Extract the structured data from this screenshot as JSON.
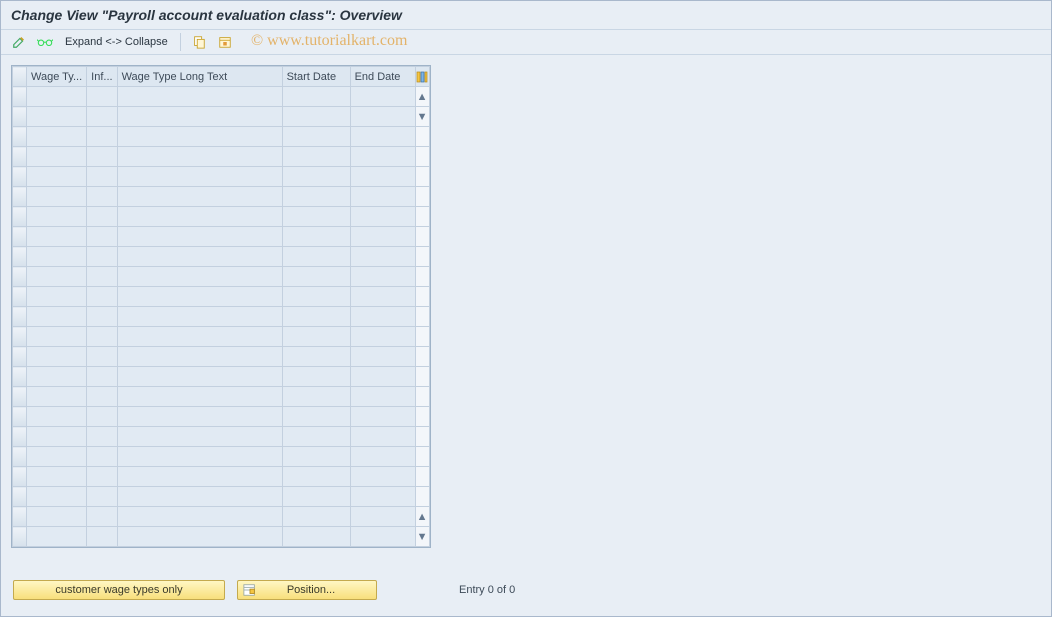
{
  "title": "Change View \"Payroll account evaluation class\": Overview",
  "toolbar": {
    "expand_collapse_label": "Expand <-> Collapse"
  },
  "watermark": "© www.tutorialkart.com",
  "columns": {
    "rowheader": "",
    "wage_type": "Wage Ty...",
    "inf": "Inf...",
    "long_text": "Wage Type Long Text",
    "start_date": "Start Date",
    "end_date": "End Date"
  },
  "footer": {
    "customer_btn": "customer wage types only",
    "position_btn": "Position...",
    "entry_label": "Entry 0 of 0"
  },
  "row_count": 23
}
